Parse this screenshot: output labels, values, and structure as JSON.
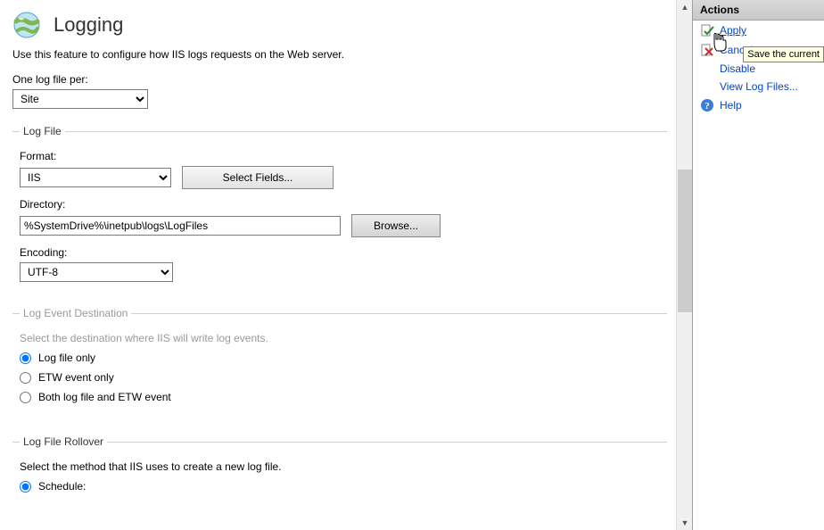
{
  "header": {
    "title": "Logging",
    "description": "Use this feature to configure how IIS logs requests on the Web server."
  },
  "one_per": {
    "label": "One log file per:",
    "value": "Site"
  },
  "log_file": {
    "legend": "Log File",
    "format_label": "Format:",
    "format_value": "IIS",
    "select_fields": "Select Fields...",
    "directory_label": "Directory:",
    "directory_value": "%SystemDrive%\\inetpub\\logs\\LogFiles",
    "browse": "Browse...",
    "encoding_label": "Encoding:",
    "encoding_value": "UTF-8"
  },
  "destination": {
    "legend": "Log Event Destination",
    "desc": "Select the destination where IIS will write log events.",
    "opt1": "Log file only",
    "opt2": "ETW event only",
    "opt3": "Both log file and ETW event"
  },
  "rollover": {
    "legend": "Log File Rollover",
    "desc": "Select the method that IIS uses to create a new log file.",
    "opt1": "Schedule:"
  },
  "actions": {
    "title": "Actions",
    "apply": "Apply",
    "cancel": "Cancel",
    "disable": "Disable",
    "view_logs": "View Log Files...",
    "help": "Help",
    "tooltip": "Save the current"
  }
}
